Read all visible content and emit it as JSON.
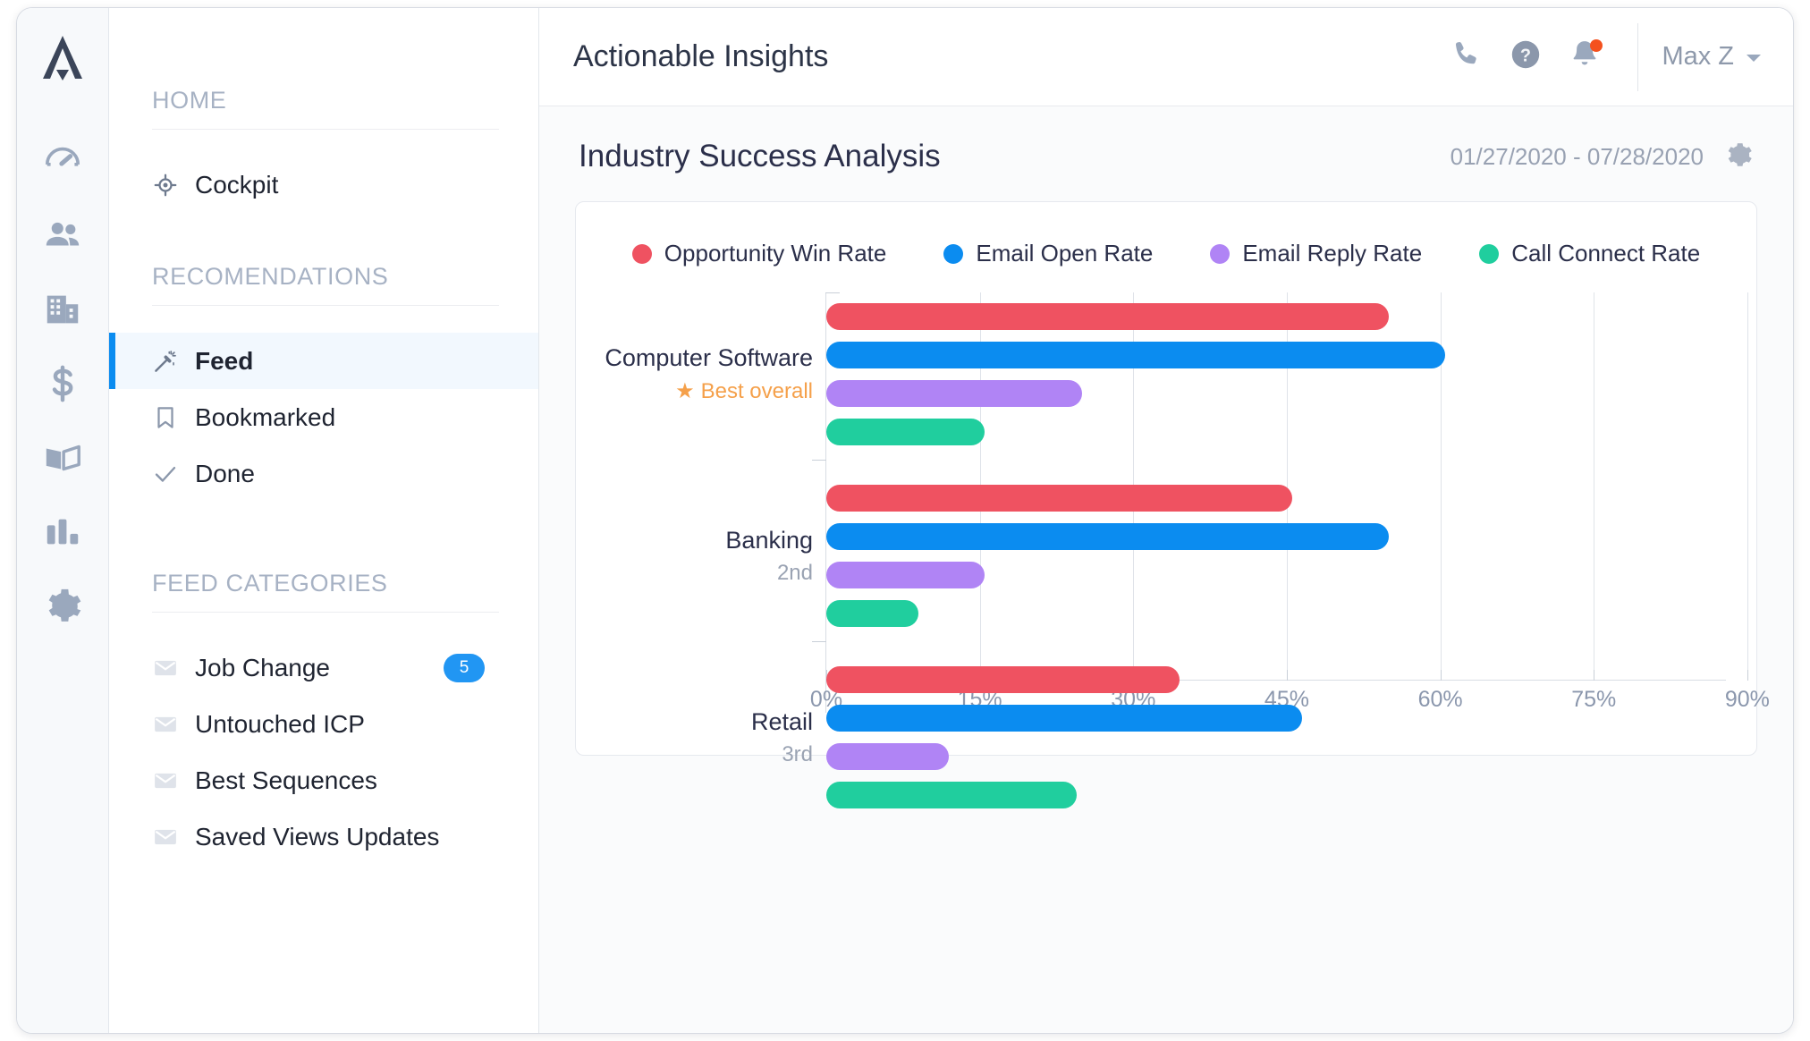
{
  "window": {
    "app_title": "Actionable Insights"
  },
  "rail": {
    "logo_name": "company-logo",
    "items": [
      {
        "icon": "dashboard-icon",
        "name": "rail-item-dashboard"
      },
      {
        "icon": "people-icon",
        "name": "rail-item-contacts"
      },
      {
        "icon": "building-icon",
        "name": "rail-item-accounts"
      },
      {
        "icon": "dollar-icon",
        "name": "rail-item-deals"
      },
      {
        "icon": "book-icon",
        "name": "rail-item-playbooks"
      },
      {
        "icon": "bar-chart-icon",
        "name": "rail-item-reports"
      },
      {
        "icon": "gear-icon",
        "name": "rail-item-settings"
      }
    ]
  },
  "topbar": {
    "phone_icon": "phone-icon",
    "help_icon": "help-circle-icon",
    "bell_icon": "bell-icon",
    "has_notification": true,
    "user_name": "Max Z"
  },
  "sidebar": {
    "sections": [
      {
        "heading": "HOME",
        "items": [
          {
            "label": "Cockpit",
            "icon": "target-icon",
            "active": false,
            "badge": ""
          }
        ]
      },
      {
        "heading": "RECOMENDATIONS",
        "items": [
          {
            "label": "Feed",
            "icon": "magic-wand-icon",
            "active": true,
            "badge": ""
          },
          {
            "label": "Bookmarked",
            "icon": "bookmark-icon",
            "active": false,
            "badge": ""
          },
          {
            "label": "Done",
            "icon": "check-icon",
            "active": false,
            "badge": ""
          }
        ]
      },
      {
        "heading": "FEED CATEGORIES",
        "items": [
          {
            "label": "Job Change",
            "icon": "envelope-icon",
            "active": false,
            "badge": "5"
          },
          {
            "label": "Untouched ICP",
            "icon": "envelope-icon",
            "active": false,
            "badge": ""
          },
          {
            "label": "Best Sequences",
            "icon": "envelope-icon",
            "active": false,
            "badge": ""
          },
          {
            "label": "Saved Views Updates",
            "icon": "envelope-icon",
            "active": false,
            "badge": ""
          }
        ]
      }
    ]
  },
  "page": {
    "title": "Industry Success Analysis",
    "date_range": "01/27/2020 - 07/28/2020",
    "settings_icon": "gear-icon"
  },
  "chart_data": {
    "type": "bar",
    "orientation": "horizontal",
    "title": "Industry Success Analysis",
    "xlabel": "",
    "ylabel": "",
    "xlim": [
      0,
      97
    ],
    "xticks": [
      0,
      15,
      30,
      45,
      60,
      75,
      90
    ],
    "xtick_labels": [
      "0%",
      "15%",
      "30%",
      "45%",
      "60%",
      "75%",
      "90%"
    ],
    "grid": true,
    "legend_position": "top-center",
    "categories": [
      "Computer Software",
      "Banking",
      "Retail"
    ],
    "category_annotations": [
      {
        "rank": "",
        "note": "Best overall",
        "note_icon": "star-icon"
      },
      {
        "rank": "2nd",
        "note": "",
        "note_icon": ""
      },
      {
        "rank": "3rd",
        "note": "",
        "note_icon": ""
      }
    ],
    "series": [
      {
        "name": "Opportunity Win Rate",
        "color": "#ef5261",
        "values": [
          55.0,
          45.5,
          34.5
        ]
      },
      {
        "name": "Email Open Rate",
        "color": "#0b8cf0",
        "values": [
          60.5,
          55.0,
          46.5
        ]
      },
      {
        "name": "Email Reply Rate",
        "color": "#b084f5",
        "values": [
          25.0,
          15.5,
          12.0
        ]
      },
      {
        "name": "Call Connect Rate",
        "color": "#20ce9e",
        "values": [
          15.5,
          9.0,
          24.5
        ]
      }
    ]
  },
  "colors": {
    "accent_blue": "#0b8cf0",
    "badge_blue": "#2196f3",
    "orange": "#f5a04a",
    "notification_red": "#f4511e",
    "text_dark": "#2b2f4a",
    "text_muted": "#9aa3b3"
  }
}
